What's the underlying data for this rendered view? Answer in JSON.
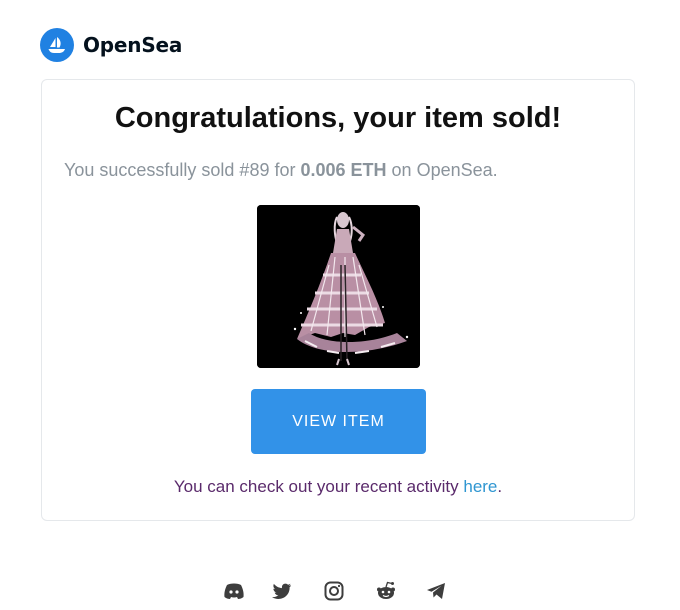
{
  "brand": {
    "name": "OpenSea",
    "logo_icon": "opensea-boat-icon",
    "accent_color": "#2081e2"
  },
  "email": {
    "title": "Congratulations, your item sold!",
    "message_prefix": "You successfully sold #89 for",
    "message_price": "0.006 ETH",
    "message_suffix": "on OpenSea.",
    "nft_image_icon": "gown-illustration",
    "view_button_label": "VIEW ITEM",
    "view_button_color": "#3292e8",
    "activity_prefix": "You can check out your recent activity",
    "activity_link": "here",
    "activity_suffix": "."
  },
  "social": {
    "icons": [
      "discord-icon",
      "twitter-icon",
      "instagram-icon",
      "reddit-icon",
      "telegram-icon"
    ]
  }
}
